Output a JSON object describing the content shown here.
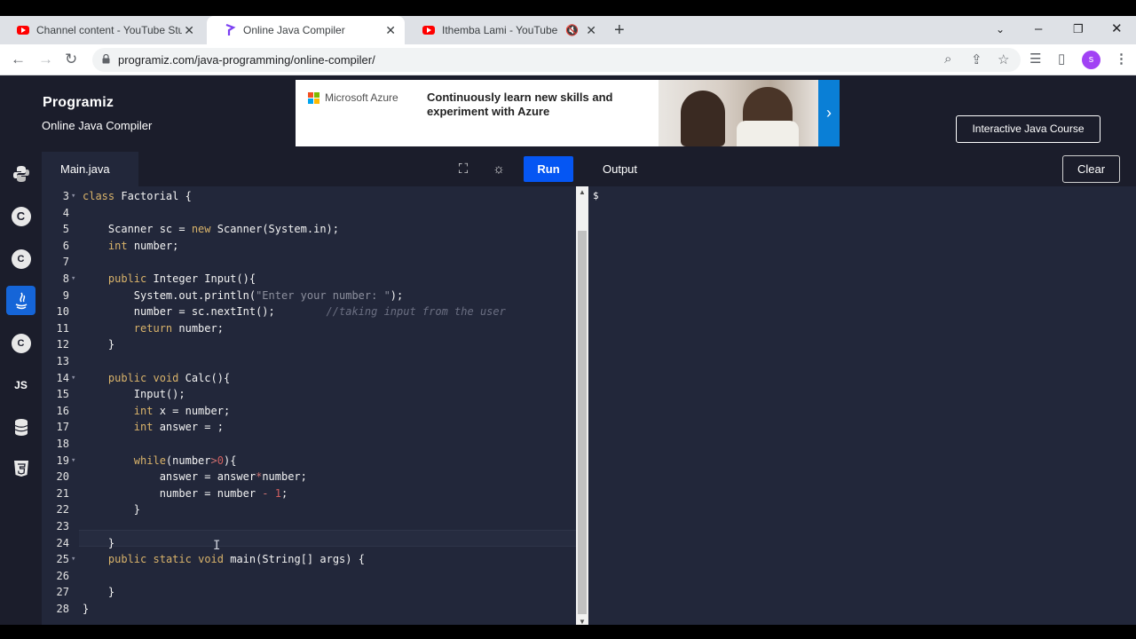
{
  "browser": {
    "tabs": [
      {
        "title": "Channel content - YouTube Studi",
        "icon": "youtube-icon"
      },
      {
        "title": "Online Java Compiler",
        "icon": "programiz-icon"
      },
      {
        "title": "Ithemba Lami - YouTube",
        "icon": "youtube-icon"
      }
    ],
    "url": "programiz.com/java-programming/online-compiler/",
    "profile_initial": "s"
  },
  "site": {
    "logo": "Programiz",
    "subtitle": "Online Java Compiler",
    "ad": {
      "brand": "Microsoft Azure",
      "text": "Continuously learn new skills and experiment with Azure"
    },
    "course_button": "Interactive Java Course"
  },
  "sidebar": {
    "languages": [
      {
        "name": "python-icon",
        "glyph": "Py"
      },
      {
        "name": "c-icon",
        "glyph": "C"
      },
      {
        "name": "cpp-icon",
        "glyph": "C"
      },
      {
        "name": "java-icon",
        "glyph": "☕",
        "active": true
      },
      {
        "name": "csharp-icon",
        "glyph": "C"
      },
      {
        "name": "javascript-icon",
        "glyph": "JS"
      },
      {
        "name": "sql-icon",
        "glyph": "≡"
      },
      {
        "name": "html-icon",
        "glyph": "5"
      }
    ]
  },
  "editor": {
    "file_tab": "Main.java",
    "run_label": "Run",
    "lines": [
      {
        "num": "3",
        "text": "class Factorial {"
      },
      {
        "num": "4",
        "text": ""
      },
      {
        "num": "5",
        "text": "    Scanner sc = new Scanner(System.in);"
      },
      {
        "num": "6",
        "text": "    int number;"
      },
      {
        "num": "7",
        "text": ""
      },
      {
        "num": "8",
        "text": "    public Integer Input(){"
      },
      {
        "num": "9",
        "text": "        System.out.println(\"Enter your number: \");"
      },
      {
        "num": "10",
        "text": "        number = sc.nextInt();        //taking input from the user"
      },
      {
        "num": "11",
        "text": "        return number;"
      },
      {
        "num": "12",
        "text": "    }"
      },
      {
        "num": "13",
        "text": ""
      },
      {
        "num": "14",
        "text": "    public void Calc(){"
      },
      {
        "num": "15",
        "text": "        Input();"
      },
      {
        "num": "16",
        "text": "        int x = number;"
      },
      {
        "num": "17",
        "text": "        int answer = ;"
      },
      {
        "num": "18",
        "text": ""
      },
      {
        "num": "19",
        "text": "        while(number>0){"
      },
      {
        "num": "20",
        "text": "            answer = answer*number;"
      },
      {
        "num": "21",
        "text": "            number = number - 1;"
      },
      {
        "num": "22",
        "text": "        }"
      },
      {
        "num": "23",
        "text": ""
      },
      {
        "num": "24",
        "text": "    }"
      },
      {
        "num": "25",
        "text": "    public static void main(String[] args) {"
      },
      {
        "num": "26",
        "text": ""
      },
      {
        "num": "27",
        "text": "    }"
      },
      {
        "num": "28",
        "text": "}"
      }
    ]
  },
  "output": {
    "label": "Output",
    "clear_label": "Clear",
    "prompt": "$"
  }
}
